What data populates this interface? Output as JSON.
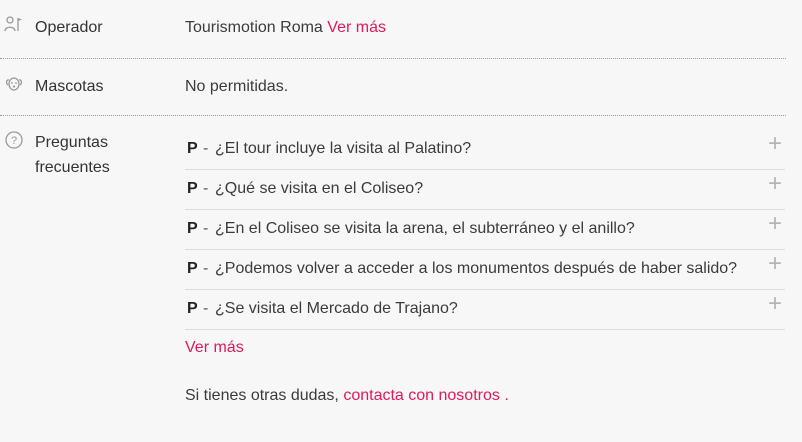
{
  "operator": {
    "label": "Operador",
    "icon": "operator-person-flag-icon",
    "value": "Tourismotion Roma",
    "link": "Ver más"
  },
  "pets": {
    "label": "Mascotas",
    "icon": "dog-icon",
    "value": "No permitidas."
  },
  "faq": {
    "label_line1": "Preguntas",
    "label_line2": "frecuentes",
    "icon": "question-circle-icon",
    "prefix": "P",
    "dash": "-",
    "items": [
      {
        "question": "¿El tour incluye la visita al Palatino?"
      },
      {
        "question": "¿Qué se visita en el Coliseo?"
      },
      {
        "question": "¿En el Coliseo se visita la arena, el subterráneo y el anillo?"
      },
      {
        "question": "¿Podemos volver a acceder a los monumentos después de haber salido?"
      },
      {
        "question": "¿Se visita el Mercado de Trajano?"
      }
    ],
    "more_link": "Ver más",
    "contact_text": "Si tienes otras dudas,",
    "contact_link": "contacta con nosotros",
    "contact_end": "."
  },
  "colors": {
    "accent": "#e0195a",
    "background": "#f7f7f7",
    "text": "#3b3b3b"
  }
}
